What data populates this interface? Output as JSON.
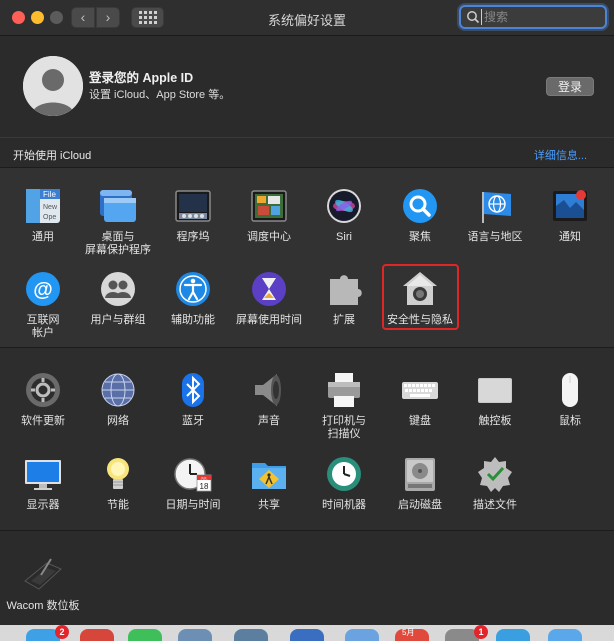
{
  "window": {
    "title": "系统偏好设置"
  },
  "search": {
    "placeholder": "搜索"
  },
  "account": {
    "title": "登录您的 Apple ID",
    "subtitle": "设置 iCloud、App Store 等。",
    "login_label": "登录"
  },
  "icloud": {
    "title": "开始使用 iCloud",
    "link": "详细信息..."
  },
  "section1": [
    {
      "label": "通用",
      "icon": "general-icon"
    },
    {
      "label": "桌面与",
      "label2": "屏幕保护程序",
      "icon": "desktop-screensaver-icon"
    },
    {
      "label": "程序坞",
      "icon": "dock-icon"
    },
    {
      "label": "调度中心",
      "icon": "mission-control-icon"
    },
    {
      "label": "Siri",
      "icon": "siri-icon"
    },
    {
      "label": "聚焦",
      "icon": "spotlight-icon"
    },
    {
      "label": "语言与地区",
      "icon": "language-region-icon"
    },
    {
      "label": "通知",
      "icon": "notifications-icon"
    },
    {
      "label": "互联网",
      "label2": "帐户",
      "icon": "internet-accounts-icon"
    },
    {
      "label": "用户与群组",
      "icon": "users-groups-icon"
    },
    {
      "label": "辅助功能",
      "icon": "accessibility-icon"
    },
    {
      "label": "屏幕使用时间",
      "icon": "screen-time-icon"
    },
    {
      "label": "扩展",
      "icon": "extensions-icon"
    },
    {
      "label": "安全性与隐私",
      "icon": "security-privacy-icon"
    }
  ],
  "section2": [
    {
      "label": "软件更新",
      "icon": "software-update-icon"
    },
    {
      "label": "网络",
      "icon": "network-icon"
    },
    {
      "label": "蓝牙",
      "icon": "bluetooth-icon"
    },
    {
      "label": "声音",
      "icon": "sound-icon"
    },
    {
      "label": "打印机与",
      "label2": "扫描仪",
      "icon": "printer-scanner-icon"
    },
    {
      "label": "键盘",
      "icon": "keyboard-icon"
    },
    {
      "label": "触控板",
      "icon": "trackpad-icon"
    },
    {
      "label": "鼠标",
      "icon": "mouse-icon"
    },
    {
      "label": "显示器",
      "icon": "displays-icon"
    },
    {
      "label": "节能",
      "icon": "energy-saver-icon"
    },
    {
      "label": "日期与时间",
      "icon": "date-time-icon"
    },
    {
      "label": "共享",
      "icon": "sharing-icon"
    },
    {
      "label": "时间机器",
      "icon": "time-machine-icon"
    },
    {
      "label": "启动磁盘",
      "icon": "startup-disk-icon"
    },
    {
      "label": "描述文件",
      "icon": "profiles-icon"
    }
  ],
  "section3": [
    {
      "label": "Wacom 数位板",
      "icon": "wacom-tablet-icon"
    }
  ],
  "dock": {
    "badge_1": "2",
    "badge_2": "1"
  },
  "icon_labels": {
    "general_file": "File",
    "general_new": "New",
    "general_ope": "Ope",
    "calendar_month": "JUL",
    "calendar_day": "18",
    "dock_calendar_month": "5月"
  }
}
